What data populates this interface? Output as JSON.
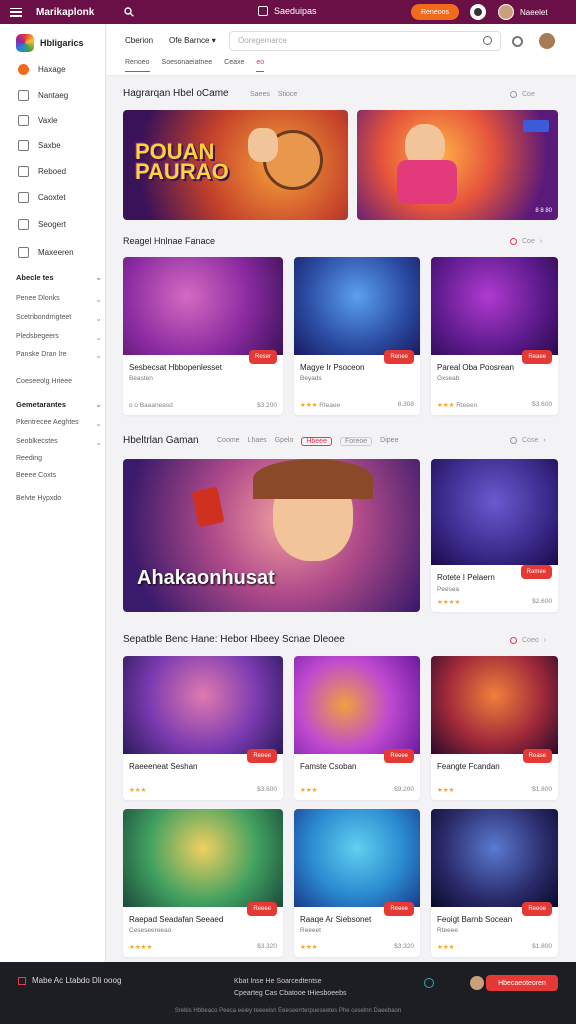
{
  "topbar": {
    "brand": "Marikaplonk",
    "center_label": "Saeduipas",
    "cta_label": "Reneoos",
    "user_label": "Naeelet"
  },
  "sidebar": {
    "logo_text": "Hbligarics",
    "items": [
      {
        "label": "Haxage",
        "icon": "home-icon"
      },
      {
        "label": "Nantaeg",
        "icon": "doc-icon"
      },
      {
        "label": "Vaxle",
        "icon": "link-icon"
      },
      {
        "label": "Saxbe",
        "icon": "list-icon"
      },
      {
        "label": "Reboed",
        "icon": "box-icon"
      },
      {
        "label": "Caoxtet",
        "icon": "grid-icon"
      },
      {
        "label": "Seogert",
        "icon": "folder-icon"
      },
      {
        "label": "Maxeeren",
        "icon": "tv-icon"
      }
    ],
    "groups": [
      {
        "label": "Abecle tes",
        "bold": true
      },
      {
        "label": "Penee Dlonks",
        "bold": false
      },
      {
        "label": "Scetribondrrigteet",
        "bold": false
      },
      {
        "label": "Pledsbegeers",
        "bold": false
      },
      {
        "label": "Panske Dran Ire",
        "bold": false
      },
      {
        "label": "Coeseeolg Hrieee",
        "bold": false
      },
      {
        "label": "Gemetarantes",
        "bold": true
      },
      {
        "label": "Pkentrecee Aeghtes",
        "bold": false
      },
      {
        "label": "Seoblkecstes",
        "bold": false
      },
      {
        "label": "Reeding",
        "bold": false
      },
      {
        "label": "Beeee Coxts",
        "bold": false
      },
      {
        "label": "Belvte Hypxdo",
        "bold": false
      }
    ]
  },
  "header": {
    "select1": "Cberion",
    "select2": "Ofe Barnce",
    "search_placeholder": "Ooregemarce",
    "tabs": [
      "Renoeo",
      "Soesonaeiatnee",
      "Ceaxe",
      "eo"
    ]
  },
  "sections": [
    {
      "title": "Hagrarqan Hbel oCame",
      "tags": [
        "Saees",
        "Stioce"
      ],
      "right": "Coe"
    },
    {
      "title": "Reagel Hnlnae Fanace",
      "tags": [],
      "right": "Coe"
    },
    {
      "title": "Hbeltrlan Gaman",
      "tags": [
        "Coome",
        "Lhaes",
        "Gpelo",
        "Hbeee",
        "Foreoe",
        "Dipee"
      ],
      "right": "Cose"
    },
    {
      "title": "Sepatble Benc Hane: Hebor Hbeey Scnae Dleoee",
      "tags": [],
      "right": "Coeo"
    }
  ],
  "banners": [
    {
      "title": "POUAN PAURAO",
      "tag": ""
    },
    {
      "title": "",
      "tag": "8 8 80"
    },
    {
      "title": "Ahakaonhusat",
      "tag": ""
    }
  ],
  "cards_row1": [
    {
      "title": "Sesbecsat Hbbopenlesset",
      "sub": "Beasten",
      "meta_left": "o o Baaaneasd",
      "meta_right": "$3.200",
      "badge": "Reser"
    },
    {
      "title": "Magye Ir Psoceon",
      "sub": "Beyads",
      "meta_left": "Rteaee",
      "meta_right": "8.308",
      "badge": "Renee"
    },
    {
      "title": "Pareal Oba Poosrean",
      "sub": "Gxseab",
      "meta_left": "Rteeen",
      "meta_right": "$3.600",
      "badge": "Reaee"
    }
  ],
  "card_featured": {
    "title": "Rotete I Pelaern",
    "sub": "Peesea",
    "meta_right": "$2.600",
    "badge": "Ramee"
  },
  "cards_row2": [
    {
      "title": "Raeeeneat Seshan",
      "meta_right": "$3.600",
      "badge": "Reeee"
    },
    {
      "title": "Famste Csoban",
      "meta_right": "$9.200",
      "badge": "Reeee"
    },
    {
      "title": "Feangte Fcandan",
      "meta_right": "$1.800",
      "badge": "Rease"
    }
  ],
  "cards_row3": [
    {
      "title": "Raepad Seadafan Seeaed",
      "sub": "Ceseseereeao",
      "meta_right": "$3.320",
      "badge": "Reeee"
    },
    {
      "title": "Raaqe Ar Siebsonet",
      "sub": "Reeeet",
      "meta_right": "$3.320",
      "badge": "Reeee"
    },
    {
      "title": "Feoigt Barnb Socean",
      "sub": "Rteeee",
      "meta_right": "$1.800",
      "badge": "Reeoe"
    }
  ],
  "footer": {
    "left": "Mabe Ac Ltabdo Dli ooog",
    "mid_line1": "Kbat Inse He Soarcedtentse",
    "mid_line2": "Cpearteg Cas Cbatooe tHiesboeebs",
    "button": "Hbecaeoteoren",
    "bottom": "Srebis Hbbeaco Peeca eeiey teeeeisn Eeeseerrterpueseetes Phe ceselnn Daeebaon"
  },
  "colors": {
    "topbar": "#6b1047",
    "accent": "#e53950",
    "cta": "#f26b1d"
  }
}
